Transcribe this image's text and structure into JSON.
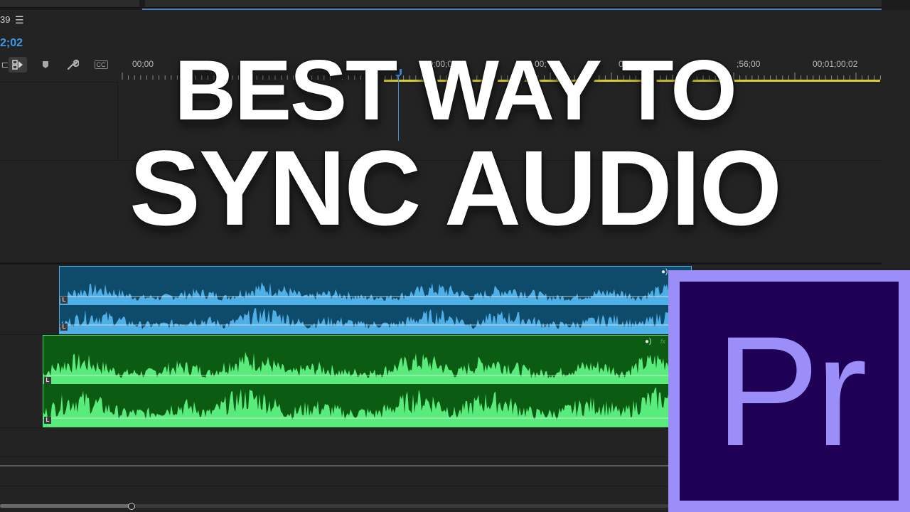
{
  "sequence": {
    "name_fragment": "39",
    "menu_icon": "hamburger-menu-icon"
  },
  "timecode": "2;02",
  "tools": [
    {
      "name": "snap-icon",
      "glyph": "⊏"
    },
    {
      "name": "linked-selection-icon",
      "glyph": "⧉"
    },
    {
      "name": "add-marker-icon",
      "glyph": "⬟"
    },
    {
      "name": "wrench-icon",
      "glyph": "🔧"
    },
    {
      "name": "captions-icon",
      "glyph": "CC"
    }
  ],
  "ruler_labels": [
    "00;00",
    "00;00;00",
    "00;",
    "00;",
    ";56;00",
    "00;01;00;02"
  ],
  "channel_badge": "L",
  "headline": {
    "line1": "BEST WAY TO",
    "line2": "SYNC AUDIO"
  },
  "logo": {
    "text": "Pr"
  },
  "colors": {
    "audio1_fill": "#4fb0e8",
    "audio2_fill": "#59ec7c",
    "logo_border": "#9b8ef8",
    "logo_bg": "#1e0054",
    "playhead": "#3f8fe6"
  }
}
